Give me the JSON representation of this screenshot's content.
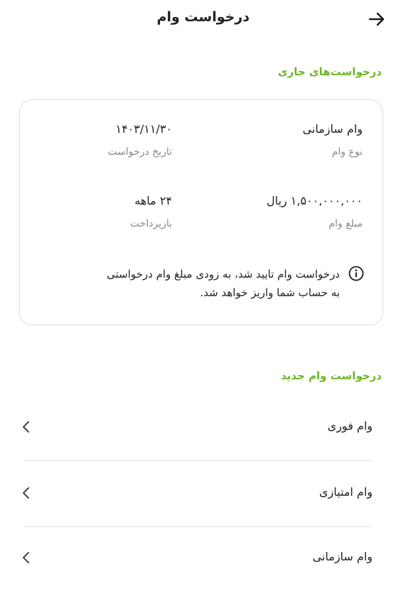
{
  "header": {
    "title": "درخواست وام",
    "back_icon": "arrow-right-icon"
  },
  "current_requests": {
    "title": "درخواست‌های جاری",
    "title_color": "#6fb52c",
    "card": {
      "loan_type": {
        "value": "وام سازمانی",
        "label": "نوع وام"
      },
      "request_date": {
        "value": "۱۴۰۳/۱۱/۳۰",
        "label": "تاریخ درخواست"
      },
      "loan_amount": {
        "value": "۱,۵۰۰,۰۰۰,۰۰۰ ریال",
        "label": "مبلغ وام"
      },
      "repayment": {
        "value": "۲۴ ماهه",
        "label": "بازپرداخت"
      },
      "info_icon": "info-circle-icon",
      "note_line1": "درخواست وام تایید شد، به زودی مبلغ وام درخواستی",
      "note_line2": "به حساب شما واریز خواهد شد."
    }
  },
  "new_request": {
    "title": "درخواست وام جدید",
    "title_color": "#6fb52c",
    "options": [
      {
        "label": "وام فوری",
        "icon": "chevron-left-icon"
      },
      {
        "label": "وام امتیازی",
        "icon": "chevron-left-icon"
      },
      {
        "label": "وام سازمانی",
        "icon": "chevron-left-icon"
      }
    ]
  }
}
